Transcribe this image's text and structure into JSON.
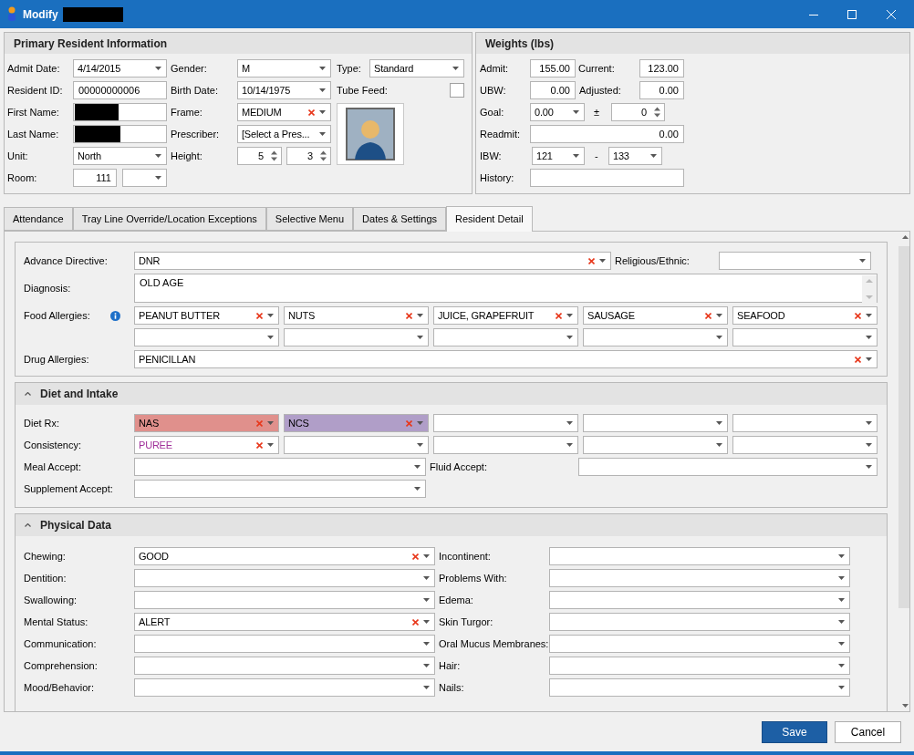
{
  "window": {
    "title": "Modify"
  },
  "primary": {
    "title": "Primary Resident Information",
    "admit_date": {
      "label": "Admit Date:",
      "value": "4/14/2015"
    },
    "gender": {
      "label": "Gender:",
      "value": "M"
    },
    "type": {
      "label": "Type:",
      "value": "Standard"
    },
    "resident_id": {
      "label": "Resident ID:",
      "value": "00000000006"
    },
    "birth_date": {
      "label": "Birth Date:",
      "value": "10/14/1975"
    },
    "tube_feed": {
      "label": "Tube Feed:",
      "checked": false
    },
    "first_name": {
      "label": "First Name:"
    },
    "frame": {
      "label": "Frame:",
      "value": "MEDIUM",
      "clearable": true
    },
    "last_name": {
      "label": "Last Name:"
    },
    "prescriber": {
      "label": "Prescriber:",
      "value": "[Select a Pres..."
    },
    "unit": {
      "label": "Unit:",
      "value": "North"
    },
    "height": {
      "label": "Height:",
      "feet": "5",
      "inches": "3"
    },
    "room": {
      "label": "Room:",
      "value": "111"
    }
  },
  "weights": {
    "title": "Weights (lbs)",
    "admit": {
      "label": "Admit:",
      "value": "155.00"
    },
    "current": {
      "label": "Current:",
      "value": "123.00"
    },
    "ubw": {
      "label": "UBW:",
      "value": "0.00"
    },
    "adjusted": {
      "label": "Adjusted:",
      "value": "0.00"
    },
    "goal": {
      "label": "Goal:",
      "value": "0.00",
      "plus_minus": "±",
      "tolerance": "0"
    },
    "readmit": {
      "label": "Readmit:",
      "value": "0.00"
    },
    "ibw": {
      "label": "IBW:",
      "low": "121",
      "dash": "-",
      "high": "133"
    },
    "history": {
      "label": "History:"
    }
  },
  "tabs": [
    {
      "label": "Attendance",
      "selected": false
    },
    {
      "label": "Tray Line Override/Location Exceptions",
      "selected": false
    },
    {
      "label": "Selective Menu",
      "selected": false
    },
    {
      "label": "Dates & Settings",
      "selected": false
    },
    {
      "label": "Resident Detail",
      "selected": true
    }
  ],
  "detail": {
    "advance_directive": {
      "label": "Advance Directive:",
      "value": "DNR",
      "clearable": true
    },
    "religious": {
      "label": "Religious/Ethnic:"
    },
    "diagnosis": {
      "label": "Diagnosis:",
      "value": "OLD AGE"
    },
    "food_allergies": {
      "label": "Food Allergies:",
      "items": [
        {
          "value": "PEANUT BUTTER",
          "clearable": true
        },
        {
          "value": "NUTS",
          "clearable": true
        },
        {
          "value": "JUICE, GRAPEFRUIT",
          "clearable": true
        },
        {
          "value": "SAUSAGE",
          "clearable": true
        },
        {
          "value": "SEAFOOD",
          "clearable": true
        },
        {
          "clearable": false
        },
        {
          "clearable": false
        },
        {
          "clearable": false
        },
        {
          "clearable": false
        },
        {
          "clearable": false
        }
      ]
    },
    "drug_allergies": {
      "label": "Drug Allergies:",
      "value": "PENICILLAN",
      "clearable": true
    }
  },
  "diet": {
    "title": "Diet and Intake",
    "expanded": true,
    "diet_rx": {
      "label": "Diet Rx:",
      "items": [
        {
          "kind": "fill",
          "value": "NAS",
          "clearable": true,
          "color": "#e0908c"
        },
        {
          "kind": "fill",
          "value": "NCS",
          "clearable": true,
          "color": "#b09ec8"
        },
        {
          "kind": "plain",
          "clearable": false
        },
        {
          "kind": "plain",
          "clearable": false
        },
        {
          "kind": "plain",
          "clearable": false
        }
      ]
    },
    "consistency": {
      "label": "Consistency:",
      "items": [
        {
          "kind": "tinted_text",
          "value": "PUREE",
          "clearable": true,
          "color": "#a0309a"
        },
        {
          "kind": "plain",
          "clearable": false
        },
        {
          "kind": "plain",
          "clearable": false
        },
        {
          "kind": "plain",
          "clearable": false
        },
        {
          "kind": "plain",
          "clearable": false
        }
      ]
    },
    "meal_accept": {
      "label": "Meal Accept:"
    },
    "fluid_accept": {
      "label": "Fluid Accept:"
    },
    "supplement_accept": {
      "label": "Supplement Accept:"
    }
  },
  "physical": {
    "title": "Physical Data",
    "expanded": true,
    "left": [
      {
        "label": "Chewing:",
        "value": "GOOD",
        "clearable": true
      },
      {
        "label": "Dentition:",
        "clearable": false
      },
      {
        "label": "Swallowing:",
        "clearable": false
      },
      {
        "label": "Mental Status:",
        "value": "ALERT",
        "clearable": true
      },
      {
        "label": "Communication:",
        "clearable": false
      },
      {
        "label": "Comprehension:",
        "clearable": false
      },
      {
        "label": "Mood/Behavior:",
        "clearable": false
      }
    ],
    "right": [
      {
        "label": "Incontinent:",
        "clearable": false
      },
      {
        "label": "Problems With:",
        "clearable": false
      },
      {
        "label": "Edema:",
        "clearable": false
      },
      {
        "label": "Skin Turgor:",
        "clearable": false
      },
      {
        "label": "Oral Mucus Membranes:",
        "clearable": false
      },
      {
        "label": "Hair:",
        "clearable": false
      },
      {
        "label": "Nails:",
        "clearable": false
      }
    ]
  },
  "buttons": {
    "save": "Save",
    "cancel": "Cancel"
  }
}
